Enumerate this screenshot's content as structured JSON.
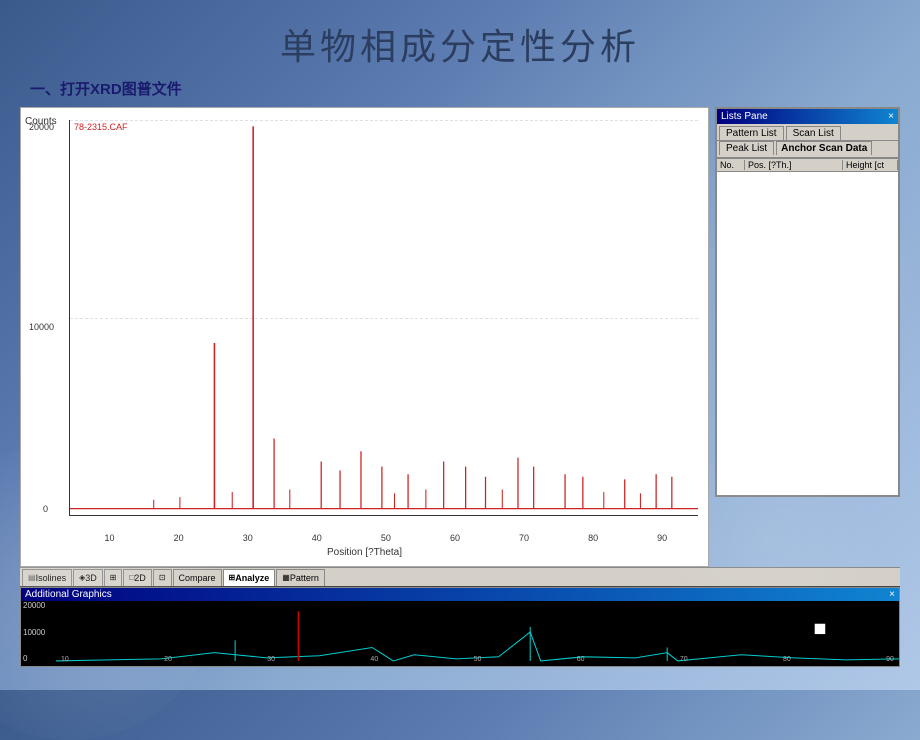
{
  "page": {
    "title": "单物相成分定性分析",
    "subtitle_prefix": "一、打开",
    "subtitle_bold": "XRD",
    "subtitle_suffix": "图普文件"
  },
  "chart": {
    "y_label": "Counts",
    "y_ticks": [
      "20000",
      "10000",
      "0"
    ],
    "x_ticks": [
      "10",
      "20",
      "30",
      "40",
      "50",
      "60",
      "70",
      "80",
      "90"
    ],
    "x_axis_title": "Position [?Theta]",
    "data_label": "78-2315.CAF"
  },
  "lists_pane": {
    "title": "Lists Pane",
    "close_btn": "×",
    "tabs_row1": [
      {
        "label": "Pattern List",
        "active": false
      },
      {
        "label": "Scan List",
        "active": false
      }
    ],
    "tabs_row2": [
      {
        "label": "Peak List",
        "active": false
      },
      {
        "label": "Anchor Scan Data",
        "active": true
      }
    ],
    "table_headers": [
      "No.",
      "Pos. [?Th.]",
      "Height [ct"
    ]
  },
  "bottom_tabs": [
    {
      "label": "Isolines",
      "icon": ""
    },
    {
      "label": "3D",
      "icon": ""
    },
    {
      "label": "",
      "icon": ""
    },
    {
      "label": "2D",
      "icon": ""
    },
    {
      "label": "",
      "icon": ""
    },
    {
      "label": "Compare",
      "icon": ""
    },
    {
      "label": "Analyze",
      "icon": "",
      "active": true
    },
    {
      "label": "Pattern",
      "icon": ""
    }
  ],
  "additional_graphics": {
    "title": "Additional Graphics",
    "y_ticks": [
      "20000",
      "10000",
      "0"
    ]
  },
  "colors": {
    "xrd_line": "#cc2222",
    "ag_main_line": "#00cccc",
    "ag_secondary_line": "#cc0000",
    "title_bar_start": "#000080",
    "title_bar_end": "#1084d0"
  }
}
